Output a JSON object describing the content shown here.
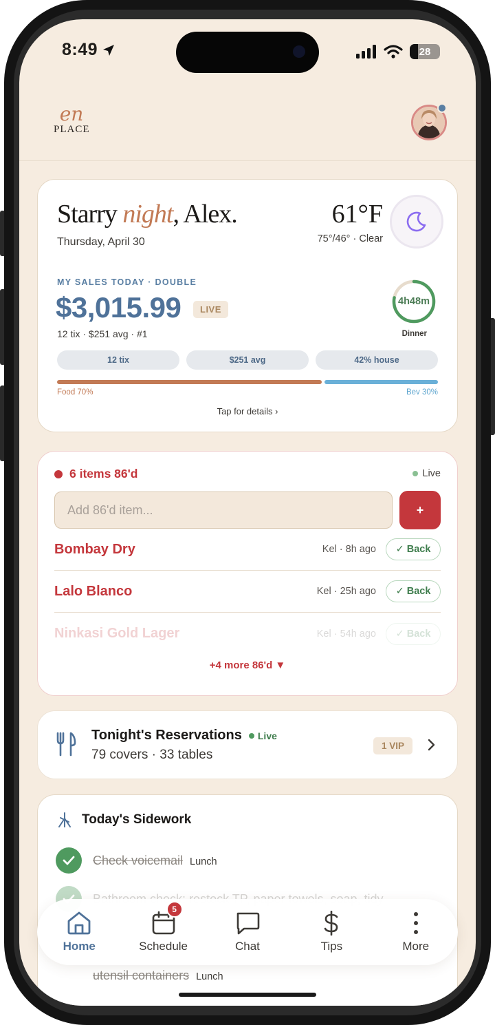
{
  "status_bar": {
    "time": "8:49",
    "battery": "28"
  },
  "header": {
    "logo_top": "en",
    "logo_bottom": "PLACE"
  },
  "greeting_card": {
    "greeting_prefix": "Starry ",
    "greeting_accent": "night",
    "greeting_suffix": ", Alex.",
    "date": "Thursday, April 30",
    "temperature": "61°F",
    "weather_detail": "75°/46° · Clear",
    "sales_label": "MY SALES TODAY · DOUBLE",
    "sales_amount": "$3,015.99",
    "live_label": "LIVE",
    "sales_sub": "12 tix · $251 avg · #1",
    "shift_timer": "4h48m",
    "shift_progress": 0.78,
    "shift_name": "Dinner",
    "stat_pills": [
      "12 tix",
      "$251 avg",
      "42% house"
    ],
    "food_pct": 70,
    "bev_pct": 30,
    "food_label": "Food 70%",
    "bev_label": "Bev 30%",
    "tap_details": "Tap for details ›"
  },
  "eighty_six": {
    "title": "6 items 86'd",
    "live_label": "Live",
    "input_placeholder": "Add 86'd item...",
    "add_label": "+",
    "items": [
      {
        "name": "Bombay Dry",
        "meta": "Kel · 8h ago",
        "action": "✓ Back"
      },
      {
        "name": "Lalo Blanco",
        "meta": "Kel · 25h ago",
        "action": "✓ Back"
      },
      {
        "name": "Ninkasi Gold Lager",
        "meta": "Kel · 54h ago",
        "action": "✓ Back"
      }
    ],
    "more_label": "+4 more 86'd ▼"
  },
  "reservations": {
    "title": "Tonight's Reservations",
    "live_label": "Live",
    "summary": "79 covers · 33 tables",
    "vip_label": "1 VIP"
  },
  "sidework": {
    "title": "Today's Sidework",
    "tasks": [
      {
        "text": "Check voicemail",
        "tag": "Lunch"
      },
      {
        "text": "Bathroom check: restock TP, paper towels, soap, tidy",
        "tag": ""
      },
      {
        "text": "utensil containers",
        "tag": "Lunch"
      }
    ]
  },
  "tabbar": {
    "tabs": [
      {
        "label": "Home",
        "icon": "home-icon"
      },
      {
        "label": "Schedule",
        "icon": "calendar-icon",
        "badge": "5"
      },
      {
        "label": "Chat",
        "icon": "chat-icon"
      },
      {
        "label": "Tips",
        "icon": "dollar-icon"
      },
      {
        "label": "More",
        "icon": "more-icon"
      }
    ]
  },
  "colors": {
    "background": "#f6ece0",
    "accent_blue": "#4f7299",
    "accent_copper": "#c27a55",
    "alert_red": "#c4373c",
    "success_green": "#4f9a5f"
  }
}
